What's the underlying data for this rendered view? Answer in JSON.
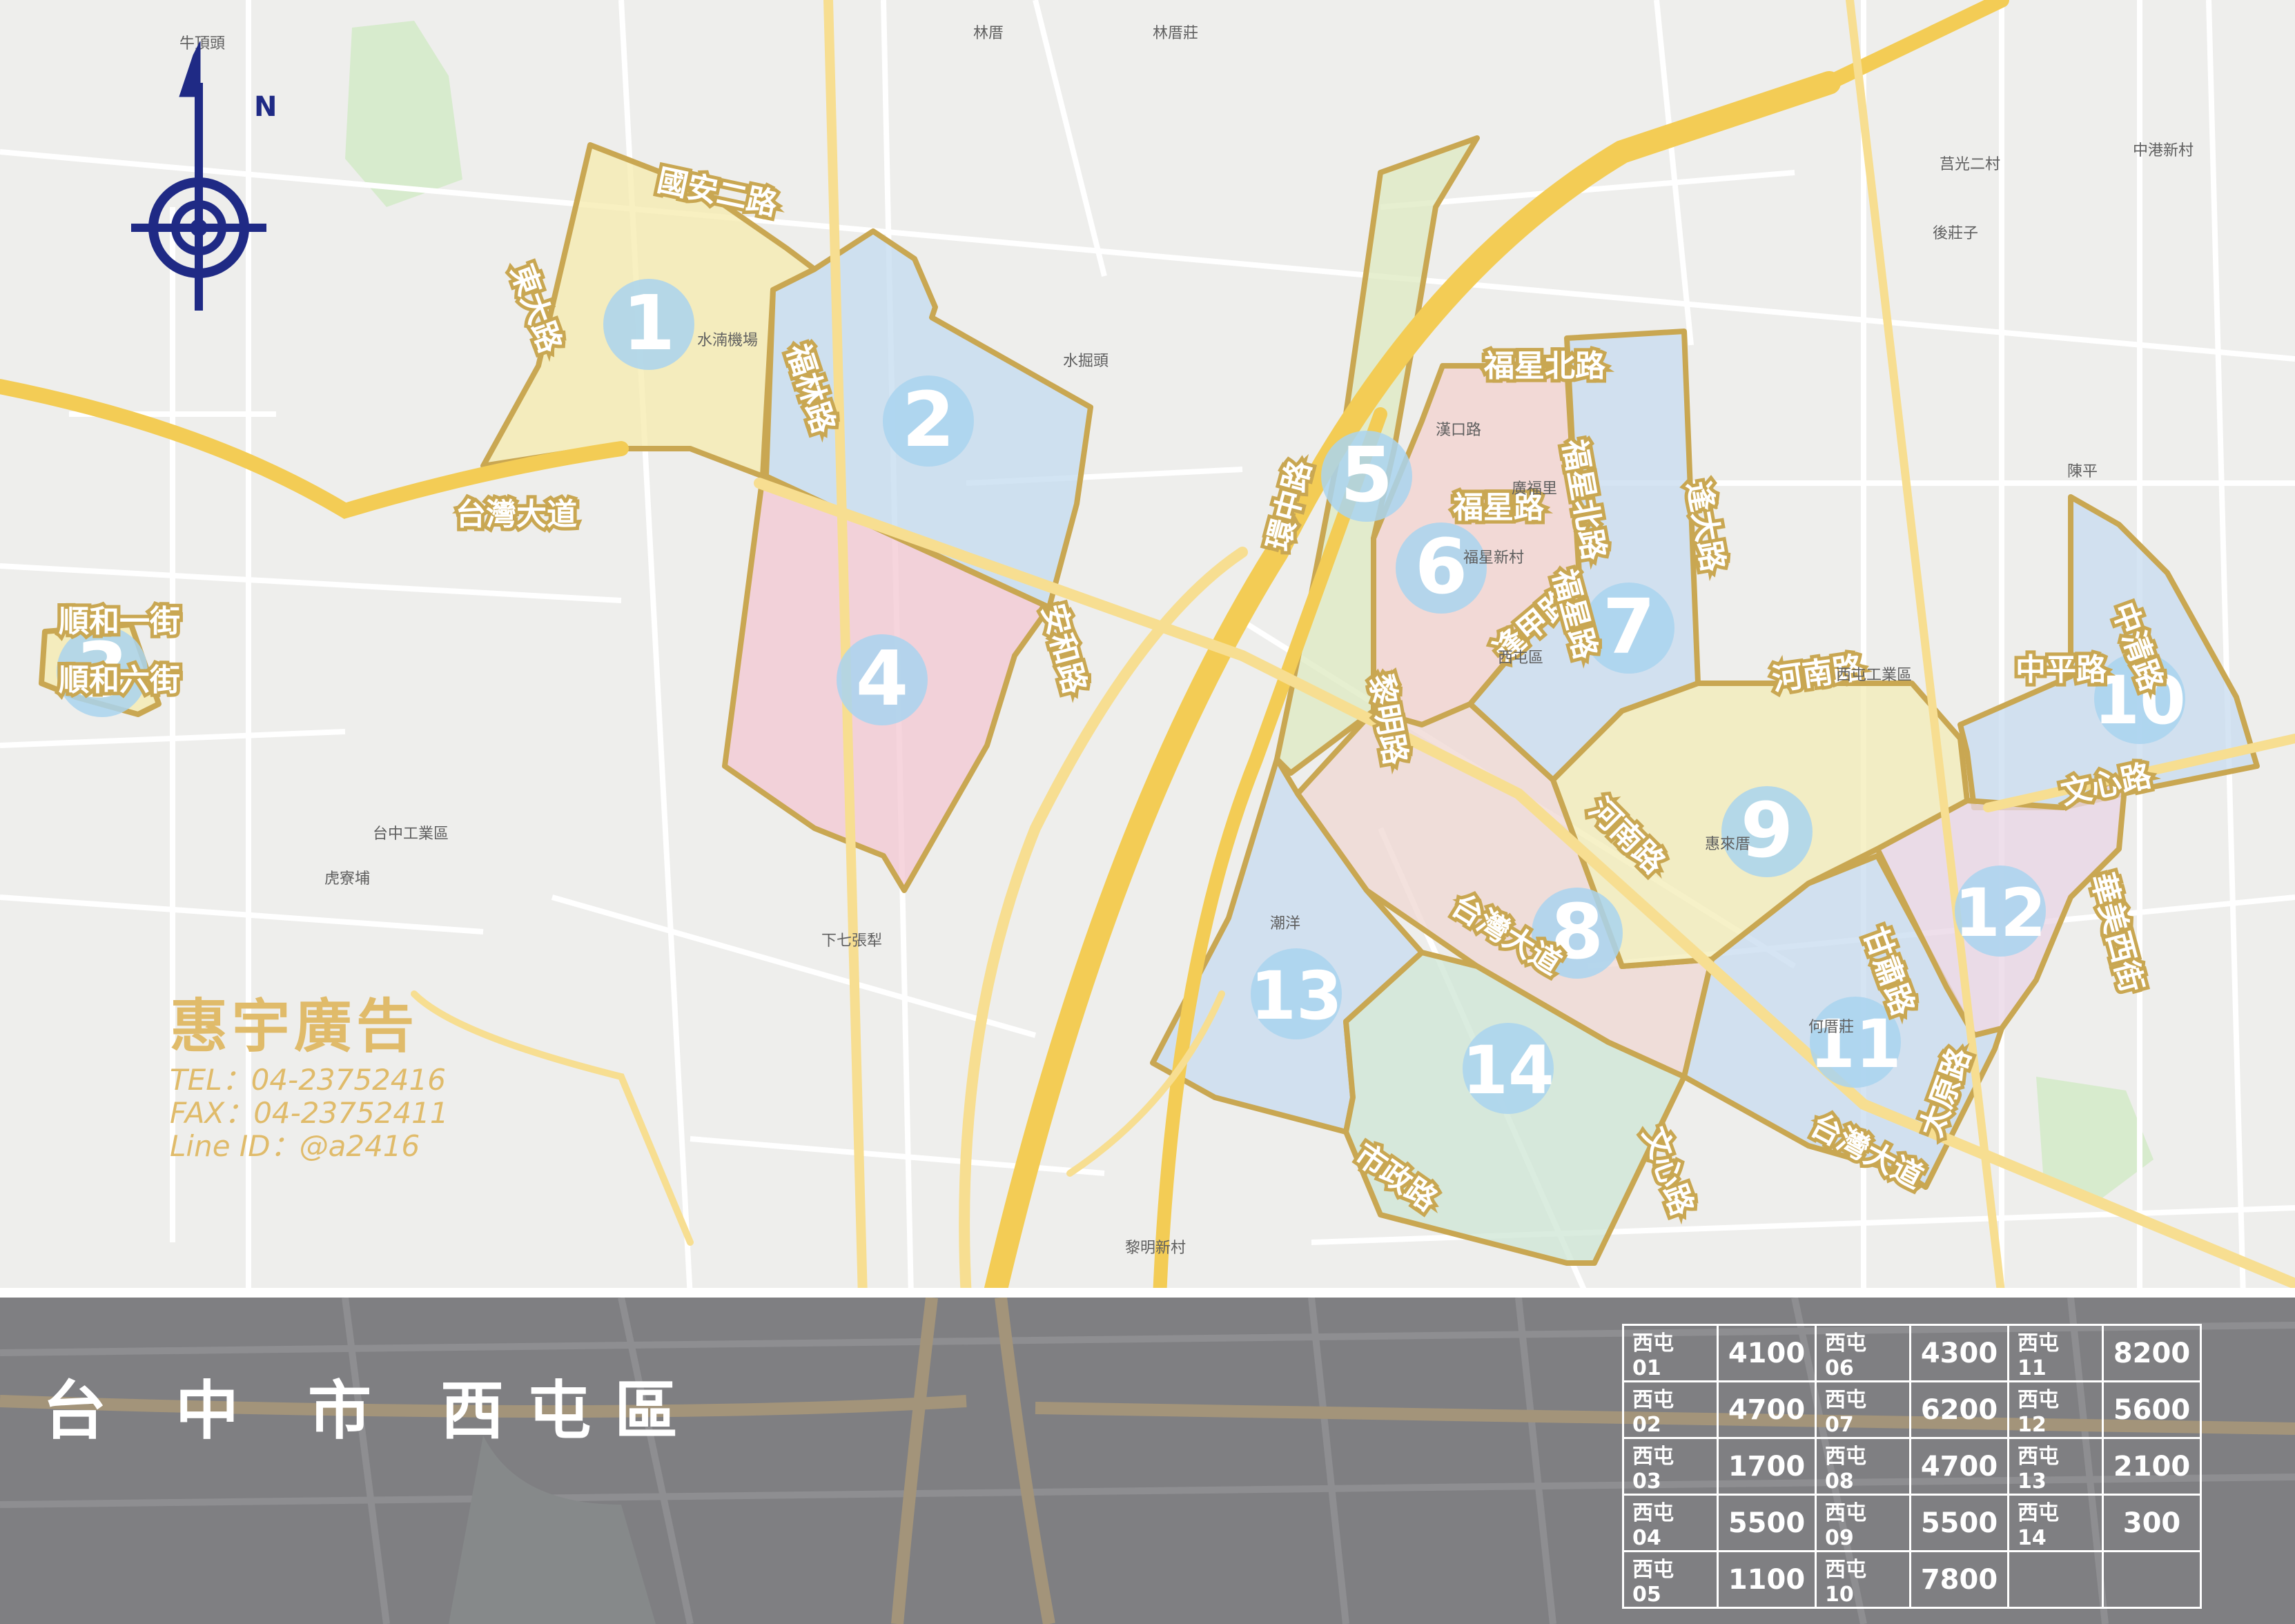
{
  "title": "台 中 市 西屯區",
  "compass": {
    "label": "N"
  },
  "brand": {
    "name": "惠宇廣告",
    "tel": "TEL：04-23752416",
    "fax": "FAX：04-23752411",
    "line": "Line ID：@a2416"
  },
  "zones": [
    {
      "number": "1",
      "color": "#f6ecb0"
    },
    {
      "number": "2",
      "color": "#c5dcf0"
    },
    {
      "number": "3",
      "color": "#f6ecb0"
    },
    {
      "number": "4",
      "color": "#f3c9d4"
    },
    {
      "number": "5",
      "color": "#dfeac3"
    },
    {
      "number": "6",
      "color": "#f3d3cf"
    },
    {
      "number": "7",
      "color": "#c9ddf0"
    },
    {
      "number": "8",
      "color": "#efd9d3"
    },
    {
      "number": "9",
      "color": "#f3edb8"
    },
    {
      "number": "10",
      "color": "#c9ddf0"
    },
    {
      "number": "11",
      "color": "#c9ddf0"
    },
    {
      "number": "12",
      "color": "#e9d6e6"
    },
    {
      "number": "13",
      "color": "#c9ddf0"
    },
    {
      "number": "14",
      "color": "#cfe7d6"
    }
  ],
  "road_labels_major": [
    "國安二路",
    "東大路",
    "福林路",
    "台灣大道",
    "安和路",
    "順和一街",
    "順和六街",
    "福星北路",
    "逢大路",
    "環中路",
    "黎明路",
    "福星路",
    "逢甲路",
    "河南路",
    "中平路",
    "中清路",
    "文心路",
    "華美西街",
    "甘肅路",
    "太原路",
    "市政路",
    "文心路",
    "河南路",
    "台灣大道",
    "台灣大道",
    "福星北路",
    "福星路"
  ],
  "place_labels": [
    "牛頂頭",
    "林厝",
    "林厝莊",
    "水掘頭",
    "漢口路",
    "惠來厝",
    "西屯區",
    "台中工業區",
    "虎寮埔",
    "下七張犁",
    "潮洋",
    "何厝莊",
    "西屯工業區",
    "陳平",
    "莒光二村",
    "後莊子",
    "中港新村",
    "黎明新村",
    "福星新村",
    "水湳機場",
    "廣福里"
  ],
  "price_table": [
    [
      {
        "code": "西屯 01",
        "value": "4100"
      },
      {
        "code": "西屯 06",
        "value": "4300"
      },
      {
        "code": "西屯 11",
        "value": "8200"
      }
    ],
    [
      {
        "code": "西屯 02",
        "value": "4700"
      },
      {
        "code": "西屯 07",
        "value": "6200"
      },
      {
        "code": "西屯 12",
        "value": "5600"
      }
    ],
    [
      {
        "code": "西屯 03",
        "value": "1700"
      },
      {
        "code": "西屯 08",
        "value": "4700"
      },
      {
        "code": "西屯 13",
        "value": "2100"
      }
    ],
    [
      {
        "code": "西屯 04",
        "value": "5500"
      },
      {
        "code": "西屯 09",
        "value": "5500"
      },
      {
        "code": "西屯 14",
        "value": "300"
      }
    ],
    [
      {
        "code": "西屯 05",
        "value": "1100"
      },
      {
        "code": "西屯 10",
        "value": "7800"
      },
      {
        "code": "",
        "value": ""
      }
    ]
  ],
  "colors": {
    "highway": "#f3cc55",
    "boundary": "#c9a752",
    "zone_badge": "#a9d3ee",
    "label_gold": "#c9a752"
  }
}
